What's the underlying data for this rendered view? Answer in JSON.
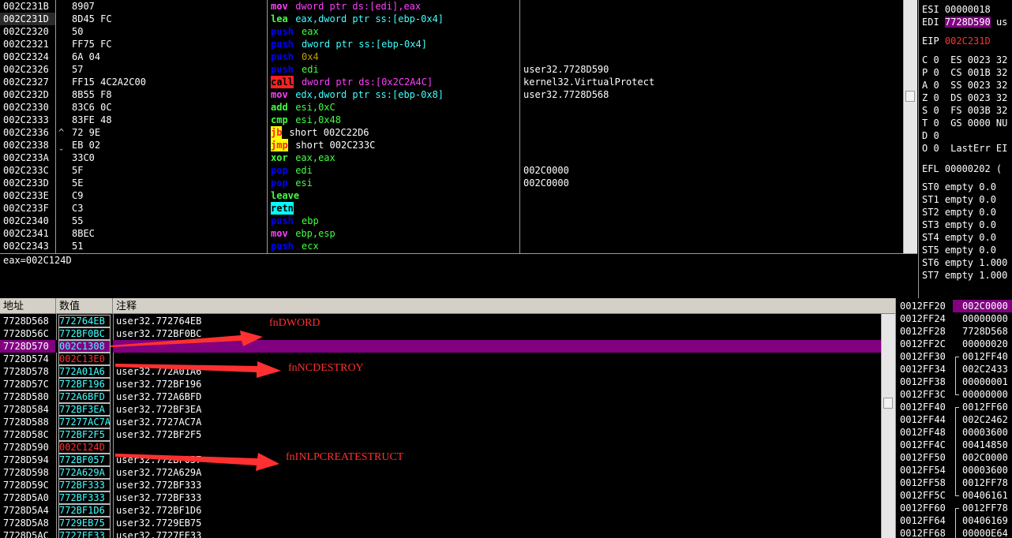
{
  "disasm": {
    "rows": [
      {
        "addr": "002C231B",
        "mark": "",
        "hex": "8907",
        "mnem": "mov",
        "mc": "#ff40ff",
        "args": "dword ptr ds:[edi],eax",
        "ac": "#ff40ff",
        "comment": "",
        "hl": ""
      },
      {
        "addr": "002C231D",
        "mark": "",
        "hex": "8D45 FC",
        "mnem": "lea",
        "mc": "#40ff40",
        "args": "eax,dword ptr ss:[ebp-0x4]",
        "ac": "#40ffff",
        "comment": "",
        "hl": ""
      },
      {
        "addr": "002C2320",
        "mark": "",
        "hex": "50",
        "mnem": "push",
        "mc": "#0000ff",
        "args": "eax",
        "ac": "#40ff40",
        "comment": "",
        "hl": ""
      },
      {
        "addr": "002C2321",
        "mark": "",
        "hex": "FF75 FC",
        "mnem": "push",
        "mc": "#0000ff",
        "args": "dword ptr ss:[ebp-0x4]",
        "ac": "#40ffff",
        "comment": "",
        "hl": ""
      },
      {
        "addr": "002C2324",
        "mark": "",
        "hex": "6A 04",
        "mnem": "push",
        "mc": "#0000ff",
        "args": "0x4",
        "ac": "#c0a000",
        "comment": "",
        "hl": ""
      },
      {
        "addr": "002C2326",
        "mark": "",
        "hex": "57",
        "mnem": "push",
        "mc": "#0000ff",
        "args": "edi",
        "ac": "#40ff40",
        "comment": "user32.7728D590",
        "hl": ""
      },
      {
        "addr": "002C2327",
        "mark": "",
        "hex": "FF15 4C2A2C00",
        "mnem": "call",
        "mc": "#000000",
        "args": "dword ptr ds:[0x2C2A4C]",
        "ac": "#ff40ff",
        "comment": "kernel32.VirtualProtect",
        "hl": "#ff2020"
      },
      {
        "addr": "002C232D",
        "mark": "",
        "hex": "8B55 F8",
        "mnem": "mov",
        "mc": "#ff40ff",
        "args": "edx,dword ptr ss:[ebp-0x8]",
        "ac": "#40ffff",
        "comment": "user32.7728D568",
        "hl": ""
      },
      {
        "addr": "002C2330",
        "mark": "",
        "hex": "83C6 0C",
        "mnem": "add",
        "mc": "#40ff40",
        "args": "esi,0xC",
        "ac": "#40ff40",
        "comment": "",
        "hl": ""
      },
      {
        "addr": "002C2333",
        "mark": "",
        "hex": "83FE 48",
        "mnem": "cmp",
        "mc": "#40ff40",
        "args": "esi,0x48",
        "ac": "#40ff40",
        "comment": "",
        "hl": ""
      },
      {
        "addr": "002C2336",
        "mark": "^",
        "hex": "72 9E",
        "mnem": "jb",
        "mc": "#ff2020",
        "args": "short 002C22D6",
        "ac": "#ffffff",
        "comment": "",
        "hl": "#ffff00"
      },
      {
        "addr": "002C2338",
        "mark": "ˬ",
        "hex": "EB 02",
        "mnem": "jmp",
        "mc": "#ff2020",
        "args": "short 002C233C",
        "ac": "#ffffff",
        "comment": "",
        "hl": "#ffff00"
      },
      {
        "addr": "002C233A",
        "mark": "",
        "hex": "33C0",
        "mnem": "xor",
        "mc": "#40ff40",
        "args": "eax,eax",
        "ac": "#40ff40",
        "comment": "",
        "hl": ""
      },
      {
        "addr": "002C233C",
        "mark": "",
        "hex": "5F",
        "mnem": "pop",
        "mc": "#0000ff",
        "args": "edi",
        "ac": "#40ff40",
        "comment": "002C0000",
        "hl": ""
      },
      {
        "addr": "002C233D",
        "mark": "",
        "hex": "5E",
        "mnem": "pop",
        "mc": "#0000ff",
        "args": "esi",
        "ac": "#40ff40",
        "comment": "002C0000",
        "hl": ""
      },
      {
        "addr": "002C233E",
        "mark": "",
        "hex": "C9",
        "mnem": "leave",
        "mc": "#40ff40",
        "args": "",
        "ac": "#40ff40",
        "comment": "",
        "hl": ""
      },
      {
        "addr": "002C233F",
        "mark": "",
        "hex": "C3",
        "mnem": "retn",
        "mc": "#000000",
        "args": "",
        "ac": "#ffffff",
        "comment": "",
        "hl": "#00ffff"
      },
      {
        "addr": "002C2340",
        "mark": "",
        "hex": "55",
        "mnem": "push",
        "mc": "#0000ff",
        "args": "ebp",
        "ac": "#40ff40",
        "comment": "",
        "hl": ""
      },
      {
        "addr": "002C2341",
        "mark": "",
        "hex": "8BEC",
        "mnem": "mov",
        "mc": "#ff40ff",
        "args": "ebp,esp",
        "ac": "#40ff40",
        "comment": "",
        "hl": ""
      },
      {
        "addr": "002C2343",
        "mark": "",
        "hex": "51",
        "mnem": "push",
        "mc": "#0000ff",
        "args": "ecx",
        "ac": "#40ff40",
        "comment": "",
        "hl": ""
      }
    ],
    "selected_index": 1
  },
  "info": {
    "text": "eax=002C124D"
  },
  "registers": {
    "esi": "ESI 00000018",
    "edi_label": "EDI",
    "edi_value": "7728D590",
    "edi_tail": "us",
    "eip_label": "EIP",
    "eip_value": "002C231D",
    "flags": [
      "C 0  ES 0023 32",
      "P 0  CS 001B 32",
      "A 0  SS 0023 32",
      "Z 0  DS 0023 32",
      "S 0  FS 003B 32",
      "T 0  GS 0000 NU",
      "D 0",
      "O 0  LastErr EI"
    ],
    "efl": "EFL 00000202 (",
    "fpu": [
      "ST0 empty 0.0",
      "ST1 empty 0.0",
      "ST2 empty 0.0",
      "ST3 empty 0.0",
      "ST4 empty 0.0",
      "ST5 empty 0.0",
      "ST6 empty 1.000",
      "ST7 empty 1.000"
    ]
  },
  "dump": {
    "headers": {
      "addr": "地址",
      "value": "数值",
      "comment": "注释"
    },
    "rows": [
      {
        "addr": "7728D568",
        "value": "772764EB",
        "comment": "user32.772764EB",
        "vc": "#40ffff"
      },
      {
        "addr": "7728D56C",
        "value": "772BF0BC",
        "comment": "user32.772BF0BC",
        "vc": "#40ffff"
      },
      {
        "addr": "7728D570",
        "value": "002C1308",
        "comment": "",
        "vc": "#40ffff"
      },
      {
        "addr": "7728D574",
        "value": "002C13E0",
        "comment": "",
        "vc": "#ff3030"
      },
      {
        "addr": "7728D578",
        "value": "772A01A6",
        "comment": "user32.772A01A6",
        "vc": "#40ffff"
      },
      {
        "addr": "7728D57C",
        "value": "772BF196",
        "comment": "user32.772BF196",
        "vc": "#40ffff"
      },
      {
        "addr": "7728D580",
        "value": "772A6BFD",
        "comment": "user32.772A6BFD",
        "vc": "#40ffff"
      },
      {
        "addr": "7728D584",
        "value": "772BF3EA",
        "comment": "user32.772BF3EA",
        "vc": "#40ffff"
      },
      {
        "addr": "7728D588",
        "value": "77277AC7A",
        "comment": "user32.7727AC7A",
        "vc": "#40ffff"
      },
      {
        "addr": "7728D58C",
        "value": "772BF2F5",
        "comment": "user32.772BF2F5",
        "vc": "#40ffff"
      },
      {
        "addr": "7728D590",
        "value": "002C124D",
        "comment": "",
        "vc": "#ff3030"
      },
      {
        "addr": "7728D594",
        "value": "772BF057",
        "comment": "user32.772BF057",
        "vc": "#40ffff"
      },
      {
        "addr": "7728D598",
        "value": "772A629A",
        "comment": "user32.772A629A",
        "vc": "#40ffff"
      },
      {
        "addr": "7728D59C",
        "value": "772BF333",
        "comment": "user32.772BF333",
        "vc": "#40ffff"
      },
      {
        "addr": "7728D5A0",
        "value": "772BF333",
        "comment": "user32.772BF333",
        "vc": "#40ffff"
      },
      {
        "addr": "7728D5A4",
        "value": "772BF1D6",
        "comment": "user32.772BF1D6",
        "vc": "#40ffff"
      },
      {
        "addr": "7728D5A8",
        "value": "7729EB75",
        "comment": "user32.7729EB75",
        "vc": "#40ffff"
      },
      {
        "addr": "7728D5AC",
        "value": "7727EE33",
        "comment": "user32.7727EE33",
        "vc": "#40ffff"
      }
    ],
    "selected_index": 2,
    "annotations": [
      "fnDWORD",
      "fnNCDESTROY",
      "fnINLPCREATESTRUCT"
    ]
  },
  "stack": {
    "rows": [
      {
        "addr": "0012FF20",
        "value": "002C0000",
        "sel": true,
        "br": ""
      },
      {
        "addr": "0012FF24",
        "value": "00000000",
        "br": ""
      },
      {
        "addr": "0012FF28",
        "value": "7728D568",
        "br": ""
      },
      {
        "addr": "0012FF2C",
        "value": "00000020",
        "br": ""
      },
      {
        "addr": "0012FF30",
        "value": "0012FF40",
        "br": "top"
      },
      {
        "addr": "0012FF34",
        "value": "002C2433",
        "br": "mid"
      },
      {
        "addr": "0012FF38",
        "value": "00000001",
        "br": "mid"
      },
      {
        "addr": "0012FF3C",
        "value": "00000000",
        "br": "bot"
      },
      {
        "addr": "0012FF40",
        "value": "0012FF60",
        "br": "top"
      },
      {
        "addr": "0012FF44",
        "value": "002C2462",
        "br": "mid"
      },
      {
        "addr": "0012FF48",
        "value": "00003600",
        "br": "mid"
      },
      {
        "addr": "0012FF4C",
        "value": "00414850",
        "br": "mid"
      },
      {
        "addr": "0012FF50",
        "value": "002C0000",
        "br": "mid"
      },
      {
        "addr": "0012FF54",
        "value": "00003600",
        "br": "mid"
      },
      {
        "addr": "0012FF58",
        "value": "0012FF78",
        "br": "mid"
      },
      {
        "addr": "0012FF5C",
        "value": "00406161",
        "br": "bot"
      },
      {
        "addr": "0012FF60",
        "value": "0012FF78",
        "br": "top"
      },
      {
        "addr": "0012FF64",
        "value": "00406169",
        "br": "mid"
      },
      {
        "addr": "0012FF68",
        "value": "00000E64",
        "br": "mid"
      }
    ]
  },
  "colors": {
    "accent_purple": "#800080",
    "annotation_red": "#ff3030"
  }
}
